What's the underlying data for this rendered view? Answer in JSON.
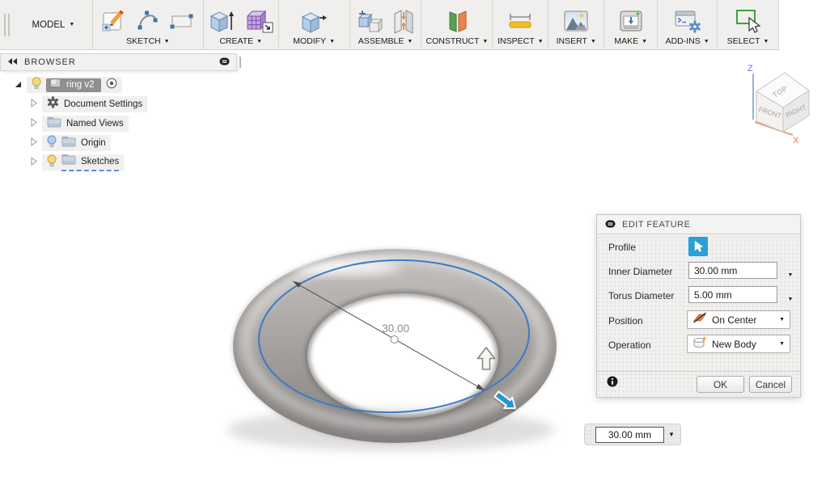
{
  "ui": {
    "caret": "▼"
  },
  "toolbar": {
    "workspace_label": "MODEL",
    "groups": [
      {
        "label": "SKETCH"
      },
      {
        "label": "CREATE"
      },
      {
        "label": "MODIFY"
      },
      {
        "label": "ASSEMBLE"
      },
      {
        "label": "CONSTRUCT"
      },
      {
        "label": "INSPECT"
      },
      {
        "label": "INSERT"
      },
      {
        "label": "MAKE"
      },
      {
        "label": "ADD-INS"
      },
      {
        "label": "SELECT"
      }
    ]
  },
  "browser": {
    "title": "BROWSER",
    "items": [
      {
        "label": "ring v2",
        "selected": true
      },
      {
        "label": "Document Settings"
      },
      {
        "label": "Named Views"
      },
      {
        "label": "Origin"
      },
      {
        "label": "Sketches"
      }
    ]
  },
  "viewport": {
    "dimension_value": "30.00",
    "viewcube": {
      "top": "TOP",
      "front": "FRONT",
      "right": "RIGHT",
      "z": "Z",
      "x": "X"
    }
  },
  "edit_feature": {
    "title": "EDIT FEATURE",
    "profile_label": "Profile",
    "inner_diameter_label": "Inner Diameter",
    "inner_diameter_value": "30.00 mm",
    "torus_diameter_label": "Torus Diameter",
    "torus_diameter_value": "5.00 mm",
    "position_label": "Position",
    "position_value": "On Center",
    "operation_label": "Operation",
    "operation_value": "New Body",
    "ok_label": "OK",
    "cancel_label": "Cancel"
  },
  "floating_input": {
    "value": "30.00 mm"
  },
  "colors": {
    "accent_blue": "#2b9fd8",
    "sketch_blue": "#3a7bc8",
    "selection_gray": "#8f8f8f",
    "axis_z_blue": "#93a6da",
    "axis_x_orange": "#e2784f",
    "construct_green": "#55a055",
    "construct_orange": "#e8854e",
    "measure_yellow": "#f2bd2a"
  }
}
